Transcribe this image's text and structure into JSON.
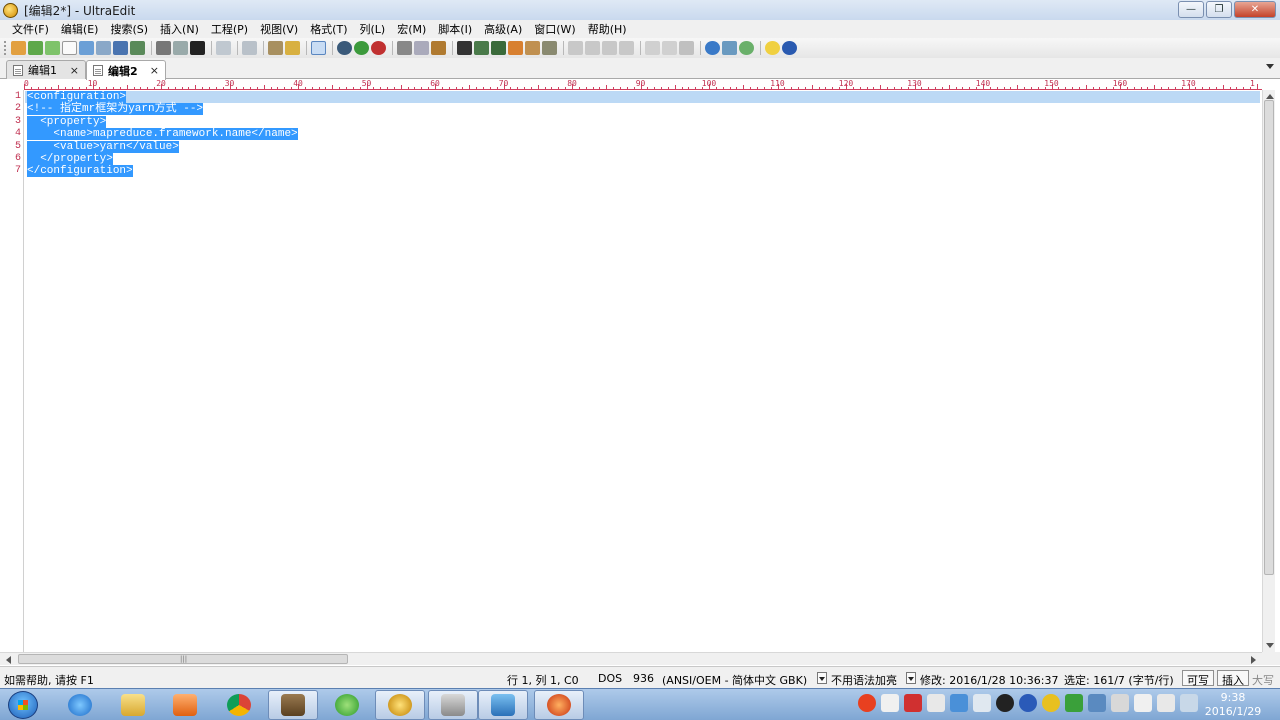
{
  "window": {
    "title": "[编辑2*] - UltraEdit",
    "minimize": "—",
    "restore": "❐",
    "close": "✕"
  },
  "menu": [
    "文件(F)",
    "编辑(E)",
    "搜索(S)",
    "插入(N)",
    "工程(P)",
    "视图(V)",
    "格式(T)",
    "列(L)",
    "宏(M)",
    "脚本(I)",
    "高级(A)",
    "窗口(W)",
    "帮助(H)"
  ],
  "tabs": [
    {
      "label": "编辑1",
      "close": "×",
      "active": false
    },
    {
      "label": "编辑2",
      "close": "×",
      "active": true
    }
  ],
  "ruler": {
    "labels": [
      "0",
      "10",
      "20",
      "30",
      "40",
      "50",
      "60",
      "70",
      "80",
      "90",
      "100",
      "110",
      "120",
      "130",
      "140",
      "150",
      "160",
      "170",
      "1"
    ]
  },
  "editor": {
    "line_numbers": [
      "1",
      "2",
      "3",
      "4",
      "5",
      "6",
      "7"
    ],
    "lines": [
      "<configuration>",
      "<!-- 指定mr框架为yarn方式 -->",
      "  <property>",
      "    <name>mapreduce.framework.name</name>",
      "    <value>yarn</value>",
      "  </property>",
      "</configuration>"
    ]
  },
  "scrollbar": {
    "grip": "|||"
  },
  "status": {
    "help": "如需帮助, 请按 F1",
    "position": "行 1, 列 1, C0",
    "line_ending": "DOS",
    "codepage": "936",
    "encoding": "(ANSI/OEM - 简体中文 GBK)",
    "syntax": "不用语法加亮",
    "modified": "修改: 2016/1/28 10:36:37",
    "selection": "选定: 161/7 (字节/行)",
    "writable": "可写",
    "insert": "插入",
    "caps": "大写"
  },
  "taskbar": {
    "time": "9:38",
    "date": "2016/1/29"
  },
  "colors": {
    "selection": "#3399ff",
    "line_number": "#c03050",
    "current_line": "#bcd9f5"
  }
}
